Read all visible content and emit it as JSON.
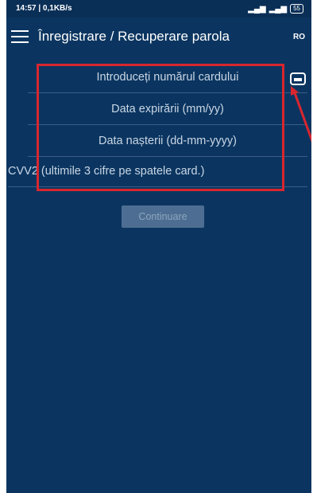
{
  "status_bar": {
    "time_info": "14:57 | 0,1KB/s",
    "battery": "55"
  },
  "app_bar": {
    "title": "Înregistrare / Recuperare parola",
    "language": "RO"
  },
  "form": {
    "card_number_placeholder": "Introduceți numărul cardului",
    "expiry_placeholder": "Data expirării (mm/yy)",
    "birth_date_placeholder": "Data nașterii (dd-mm-yyyy)",
    "cvv_placeholder": "CVV2 (ultimile 3 cifre pe spatele card.)"
  },
  "actions": {
    "continue_label": "Continuare"
  },
  "colors": {
    "background": "#0b3560",
    "highlight": "#d9262e",
    "button": "#4d6e92"
  }
}
